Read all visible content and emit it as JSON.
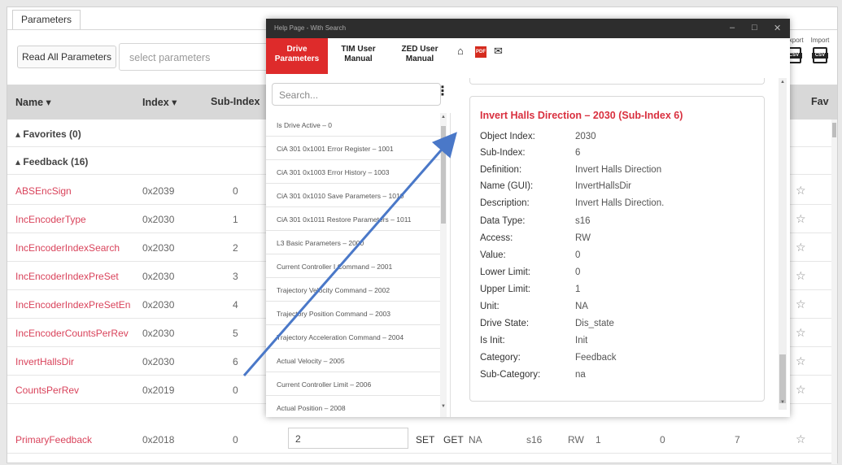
{
  "app": {
    "tab": "Parameters",
    "read_all": "Read All Parameters",
    "select_placeholder": "select parameters",
    "export_label": "Export",
    "import_label": "Import",
    "csv_icon": "csv-file-icon"
  },
  "table": {
    "headers": {
      "name": "Name ▾",
      "index": "Index ▾",
      "subindex": "Sub-Index",
      "fav": "Fav"
    },
    "groups": [
      "▴ Favorites (0)",
      "▴ Feedback (16)"
    ],
    "rows": [
      {
        "name": "ABSEncSign",
        "index": "0x2039",
        "sub": "0",
        "star": "☆"
      },
      {
        "name": "IncEncoderType",
        "index": "0x2030",
        "sub": "1",
        "star": "☆"
      },
      {
        "name": "IncEncoderIndexSearch",
        "index": "0x2030",
        "sub": "2",
        "star": "☆"
      },
      {
        "name": "IncEncoderIndexPreSet",
        "index": "0x2030",
        "sub": "3",
        "star": "☆"
      },
      {
        "name": "IncEncoderIndexPreSetEn",
        "index": "0x2030",
        "sub": "4",
        "star": "☆"
      },
      {
        "name": "IncEncoderCountsPerRev",
        "index": "0x2030",
        "sub": "5",
        "star": "☆"
      },
      {
        "name": "InvertHallsDir",
        "index": "0x2030",
        "sub": "6",
        "star": "☆"
      },
      {
        "name": "CountsPerRev",
        "index": "0x2019",
        "sub": "0",
        "star": "☆"
      },
      {
        "name": "PrimaryFeedback",
        "index": "0x2018",
        "sub": "0",
        "star": "☆"
      }
    ],
    "primary_feedback_extra": {
      "value": "2",
      "set": "SET",
      "get": "GET",
      "unit": "NA",
      "type": "s16",
      "access": "RW",
      "v1": "1",
      "v2": "0",
      "v3": "7"
    }
  },
  "help": {
    "title": "Help Page - With Search",
    "window_controls": {
      "min": "–",
      "max": "□",
      "close": "✕"
    },
    "tabs": [
      {
        "line1": "Drive",
        "line2": "Parameters"
      },
      {
        "line1": "TIM User",
        "line2": "Manual"
      },
      {
        "line1": "ZED User",
        "line2": "Manual"
      }
    ],
    "icons": {
      "home": "⌂",
      "pdf": "PDF",
      "mail": "✉"
    },
    "search_placeholder": "Search...",
    "menu_glyph": "⋮",
    "list": [
      "Is Drive Active – 0",
      "CiA 301 0x1001 Error Register – 1001",
      "CiA 301 0x1003 Error History – 1003",
      "CiA 301 0x1010 Save Parameters – 1010",
      "CiA 301 0x1011 Restore Parameters – 1011",
      "L3 Basic Parameters – 2000",
      "Current Controller I Command – 2001",
      "Trajectory Velocity Command – 2002",
      "Trajectory Position Command – 2003",
      "Trajectory Acceleration Command – 2004",
      "Actual Velocity – 2005",
      "Current Controller Limit – 2006",
      "Actual Position – 2008"
    ],
    "detail": {
      "title": "Invert Halls Direction – 2030 (Sub-Index 6)",
      "fields": [
        {
          "label": "Object Index:",
          "value": "2030"
        },
        {
          "label": "Sub-Index:",
          "value": "6"
        },
        {
          "label": "Definition:",
          "value": "Invert Halls Direction"
        },
        {
          "label": "Name (GUI):",
          "value": "InvertHallsDir"
        },
        {
          "label": "Description:",
          "value": "Invert Halls Direction."
        },
        {
          "label": "Data Type:",
          "value": "s16"
        },
        {
          "label": "Access:",
          "value": "RW"
        },
        {
          "label": "Value:",
          "value": "0"
        },
        {
          "label": "Lower Limit:",
          "value": "0"
        },
        {
          "label": "Upper Limit:",
          "value": "1"
        },
        {
          "label": "Unit:",
          "value": "NA"
        },
        {
          "label": "Drive State:",
          "value": "Dis_state"
        },
        {
          "label": "Is Init:",
          "value": "Init"
        },
        {
          "label": "Category:",
          "value": "Feedback"
        },
        {
          "label": "Sub-Category:",
          "value": "na"
        }
      ]
    }
  },
  "colors": {
    "accent_red": "#de2b2b",
    "name_pink": "#d9435b",
    "arrow_blue": "#4a78c8"
  }
}
